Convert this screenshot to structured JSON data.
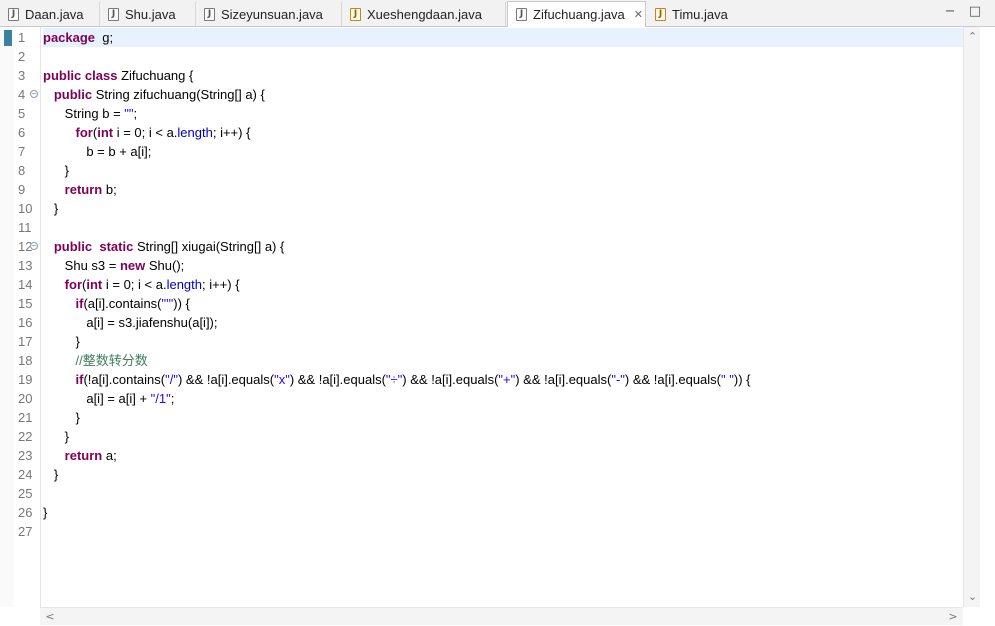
{
  "tabs": [
    {
      "label": "Daan.java",
      "icon": "java-file-icon"
    },
    {
      "label": "Shu.java",
      "icon": "java-file-icon"
    },
    {
      "label": "Sizeyunsuan.java",
      "icon": "java-file-icon"
    },
    {
      "label": "Xueshengdaan.java",
      "icon": "java-file-icon"
    },
    {
      "label": "Zifuchuang.java",
      "icon": "java-file-icon",
      "active": true,
      "close": "✕"
    },
    {
      "label": "Timu.java",
      "icon": "java-file-icon"
    }
  ],
  "window": {
    "minimize": "−",
    "maximize": "□"
  },
  "icons": {
    "java_glyph": "J",
    "fold_glyph": "−"
  },
  "editor": {
    "line_numbers": [
      "1",
      "2",
      "3",
      "4",
      "5",
      "6",
      "7",
      "8",
      "9",
      "10",
      "11",
      "12",
      "13",
      "14",
      "15",
      "16",
      "17",
      "18",
      "19",
      "20",
      "21",
      "22",
      "23",
      "24",
      "25",
      "26",
      "27"
    ],
    "fold_lines": [
      "4",
      "12"
    ],
    "lines": [
      [
        [
          "kw",
          "package"
        ],
        [
          "",
          "  g;"
        ]
      ],
      [],
      [
        [
          "kw",
          "public"
        ],
        [
          "",
          " "
        ],
        [
          "kw",
          "class"
        ],
        [
          "",
          " Zifuchuang {"
        ]
      ],
      [
        [
          "",
          "   "
        ],
        [
          "kw",
          "public"
        ],
        [
          "",
          " String zifuchuang(String[] a) {"
        ]
      ],
      [
        [
          "",
          "      String b = "
        ],
        [
          "st",
          "\"\""
        ],
        [
          "",
          ";"
        ]
      ],
      [
        [
          "",
          "         "
        ],
        [
          "kw",
          "for"
        ],
        [
          "",
          "("
        ],
        [
          "kw",
          "int"
        ],
        [
          "",
          " i = 0; i < a."
        ],
        [
          "fd",
          "length"
        ],
        [
          "",
          "; i++) {"
        ]
      ],
      [
        [
          "",
          "            b = b + a[i];"
        ]
      ],
      [
        [
          "",
          "      }"
        ]
      ],
      [
        [
          "",
          "      "
        ],
        [
          "kw",
          "return"
        ],
        [
          "",
          " b;"
        ]
      ],
      [
        [
          "",
          "   }"
        ]
      ],
      [],
      [
        [
          "",
          "   "
        ],
        [
          "kw",
          "public"
        ],
        [
          "",
          "  "
        ],
        [
          "kw",
          "static"
        ],
        [
          "",
          " String[] xiugai(String[] a) {"
        ]
      ],
      [
        [
          "",
          "      Shu s3 = "
        ],
        [
          "kw",
          "new"
        ],
        [
          "",
          " Shu();"
        ]
      ],
      [
        [
          "",
          "      "
        ],
        [
          "kw",
          "for"
        ],
        [
          "",
          "("
        ],
        [
          "kw",
          "int"
        ],
        [
          "",
          " i = 0; i < a."
        ],
        [
          "fd",
          "length"
        ],
        [
          "",
          "; i++) {"
        ]
      ],
      [
        [
          "",
          "         "
        ],
        [
          "kw",
          "if"
        ],
        [
          "",
          "(a[i].contains("
        ],
        [
          "st",
          "\"'\""
        ],
        [
          "",
          ")) {"
        ]
      ],
      [
        [
          "",
          "            a[i] = s3.jiafenshu(a[i]);"
        ]
      ],
      [
        [
          "",
          "         }"
        ]
      ],
      [
        [
          "",
          "         "
        ],
        [
          "cm",
          "//整数转分数"
        ]
      ],
      [
        [
          "",
          "         "
        ],
        [
          "kw",
          "if"
        ],
        [
          "",
          "(!a[i].contains("
        ],
        [
          "st",
          "\"/\""
        ],
        [
          "",
          ") && !a[i].equals("
        ],
        [
          "st",
          "\"x\""
        ],
        [
          "",
          ") && !a[i].equals("
        ],
        [
          "st",
          "\"÷\""
        ],
        [
          "",
          ") && !a[i].equals("
        ],
        [
          "st",
          "\"+\""
        ],
        [
          "",
          ") && !a[i].equals("
        ],
        [
          "st",
          "\"-\""
        ],
        [
          "",
          ") && !a[i].equals("
        ],
        [
          "st",
          "\" \""
        ],
        [
          "",
          ")) {"
        ]
      ],
      [
        [
          "",
          "            a[i] = a[i] + "
        ],
        [
          "st",
          "\"/1\""
        ],
        [
          "",
          ";"
        ]
      ],
      [
        [
          "",
          "         }"
        ]
      ],
      [
        [
          "",
          "      }"
        ]
      ],
      [
        [
          "",
          "      "
        ],
        [
          "kw",
          "return"
        ],
        [
          "",
          " a;"
        ]
      ],
      [
        [
          "",
          "   }"
        ]
      ],
      [],
      [
        [
          "",
          "}"
        ]
      ],
      []
    ]
  },
  "scrollbars": {
    "up": "⌃",
    "down": "⌄",
    "left": "<",
    "right": ">"
  }
}
